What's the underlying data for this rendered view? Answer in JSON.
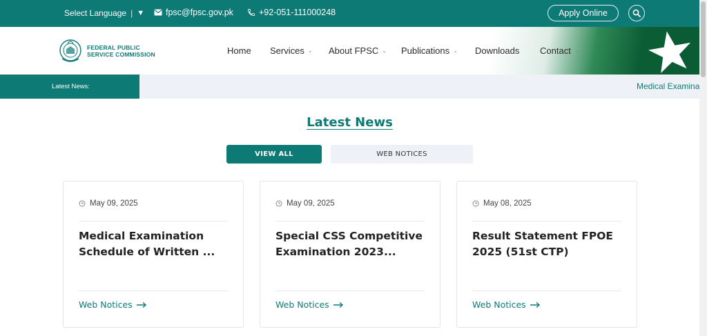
{
  "topbar": {
    "language_label": "Select Language",
    "email": "fpsc@fpsc.gov.pk",
    "phone": "+92-051-111000248",
    "apply_label": "Apply Online"
  },
  "brand": {
    "line1": "FEDERAL PUBLIC",
    "line2": "SERVICE COMMISSION",
    "accent": "#0d7a76"
  },
  "nav": [
    {
      "label": "Home",
      "has_dropdown": false
    },
    {
      "label": "Services",
      "has_dropdown": true
    },
    {
      "label": "About FPSC",
      "has_dropdown": true
    },
    {
      "label": "Publications",
      "has_dropdown": true
    },
    {
      "label": "Downloads",
      "has_dropdown": false
    },
    {
      "label": "Contact",
      "has_dropdown": true
    }
  ],
  "ticker": {
    "label": "Latest News:",
    "text": "Medical Examina"
  },
  "section": {
    "title": "Latest News",
    "filters": [
      "VIEW ALL",
      "WEB NOTICES"
    ]
  },
  "cards": [
    {
      "date": "May 09, 2025",
      "title": "Medical Examination Schedule of Written ...",
      "link": "Web Notices"
    },
    {
      "date": "May 09, 2025",
      "title": "Special CSS Competitive Examination 2023...",
      "link": "Web Notices"
    },
    {
      "date": "May 08, 2025",
      "title": "Result Statement FPOE 2025 (51st CTP)",
      "link": "Web Notices"
    }
  ]
}
